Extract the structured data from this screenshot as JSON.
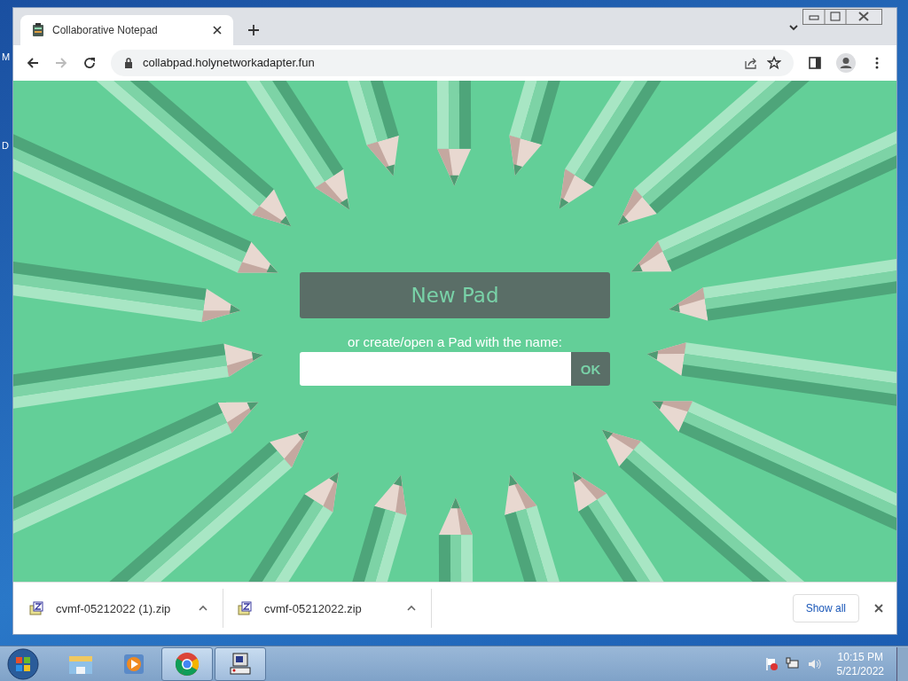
{
  "desktop_labels": [
    "M",
    "D"
  ],
  "browser": {
    "tab": {
      "title": "Collaborative Notepad",
      "selected": true
    },
    "address": "collabpad.holynetworkadapter.fun"
  },
  "page": {
    "heading": "New Pad",
    "prompt": "or create/open a Pad with the name:",
    "ok_button": "OK"
  },
  "downloads": [
    {
      "filename": "cvmf-05212022 (1).zip"
    },
    {
      "filename": "cvmf-05212022.zip"
    }
  ],
  "show_all": "Show all",
  "taskbar": {
    "apps": [
      {
        "kind": "explorer",
        "active": false
      },
      {
        "kind": "media",
        "active": false
      },
      {
        "kind": "chrome",
        "active": true
      },
      {
        "kind": "network",
        "active": true
      }
    ],
    "time": "10:15 PM",
    "date": "5/21/2022"
  }
}
